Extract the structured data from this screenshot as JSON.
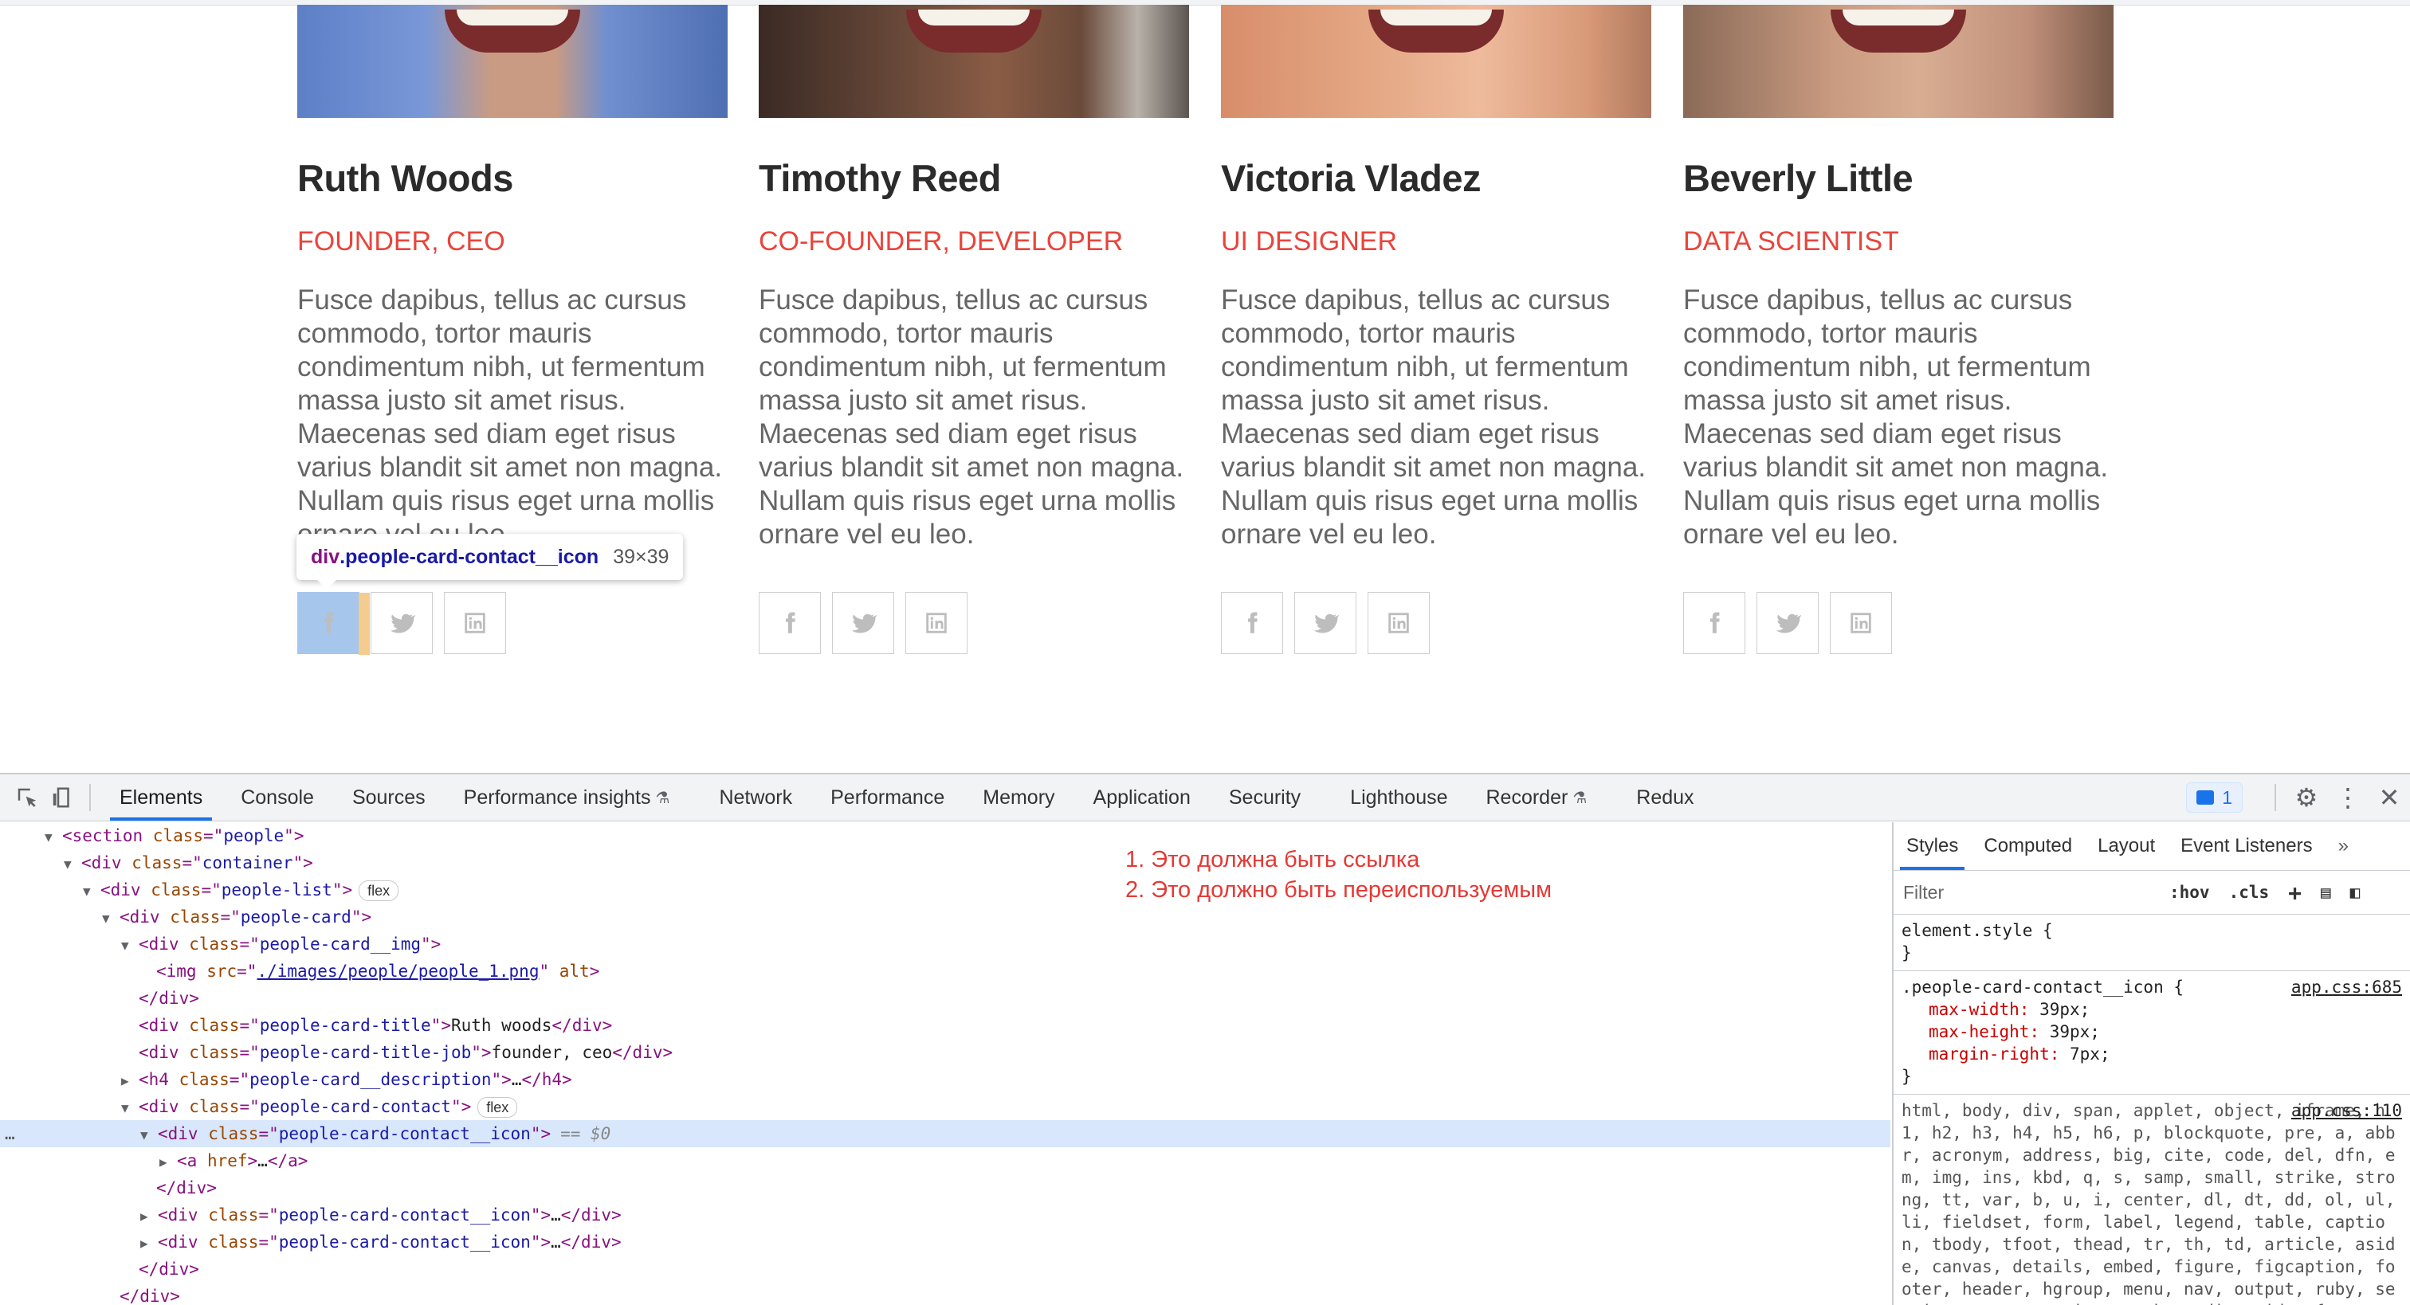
{
  "people": [
    {
      "name": "Ruth Woods",
      "job": "FOUNDER, CEO",
      "description": "Fusce dapibus, tellus ac cursus commodo, tortor mauris condimentum nibh, ut fermentum massa justo sit amet risus. Maecenas sed diam eget risus varius blandit sit amet non magna. Nullam quis risus eget urna mollis ornare vel eu leo.",
      "photo_color": "#6f8fd0"
    },
    {
      "name": "Timothy Reed",
      "job": "CO-FOUNDER, DEVELOPER",
      "description": "Fusce dapibus, tellus ac cursus commodo, tortor mauris condimentum nibh, ut fermentum massa justo sit amet risus. Maecenas sed diam eget risus varius blandit sit amet non magna. Nullam quis risus eget urna mollis ornare vel eu leo.",
      "photo_color": "#6b4a3a"
    },
    {
      "name": "Victoria Vladez",
      "job": "UI DESIGNER",
      "description": "Fusce dapibus, tellus ac cursus commodo, tortor mauris condimentum nibh, ut fermentum massa justo sit amet risus. Maecenas sed diam eget risus varius blandit sit amet non magna. Nullam quis risus eget urna mollis ornare vel eu leo.",
      "photo_color": "#e0a27f"
    },
    {
      "name": "Beverly Little",
      "job": "DATA SCIENTIST",
      "description": "Fusce dapibus, tellus ac cursus commodo, tortor mauris condimentum nibh, ut fermentum massa justo sit amet risus. Maecenas sed diam eget risus varius blandit sit amet non magna. Nullam quis risus eget urna mollis ornare vel eu leo.",
      "photo_color": "#c99b80"
    }
  ],
  "social_icons": [
    "facebook-icon",
    "twitter-icon",
    "linkedin-icon"
  ],
  "tooltip": {
    "tag": "div",
    "cls": ".people-card-contact__icon",
    "size": "39×39"
  },
  "devtools": {
    "tabs": [
      "Elements",
      "Console",
      "Sources",
      "Performance insights",
      "Network",
      "Performance",
      "Memory",
      "Application",
      "Security",
      "Lighthouse",
      "Recorder",
      "Redux"
    ],
    "active_tab": "Elements",
    "issues_count": "1",
    "note_lines": [
      "1. Это должна быть ссылка",
      "2. Это должно быть переиспользуемым"
    ],
    "dom": {
      "l1_attr": "class",
      "l1_val": "people",
      "l2_val": "container",
      "l3_val": "people-list",
      "l3_pill": "flex",
      "l4_val": "people-card",
      "l5_val": "people-card__img",
      "l6_src": "./images/people/people_1.png",
      "l6_alt": "alt",
      "l8_val": "people-card-title",
      "l8_text": "Ruth woods",
      "l9_val": "people-card-title-job",
      "l9_text": "founder, ceo",
      "l10_val": "people-card__description",
      "l11_val": "people-card-contact",
      "l11_pill": "flex",
      "l12_val": "people-card-contact__icon",
      "l12_marker": "== $0",
      "l13_text": "href",
      "l15_val": "people-card-contact__icon",
      "l16_val": "people-card-contact__icon"
    },
    "styles": {
      "tabs": [
        "Styles",
        "Computed",
        "Layout",
        "Event Listeners"
      ],
      "active_tab": "Styles",
      "filter_placeholder": "Filter",
      "hov": ":hov",
      "cls": ".cls",
      "element_style": "element.style {",
      "close_brace": "}",
      "rule1_selector": ".people-card-contact__icon {",
      "rule1_source": "app.css:685",
      "rule1_props": [
        {
          "name": "max-width",
          "value": "39px;"
        },
        {
          "name": "max-height",
          "value": "39px;"
        },
        {
          "name": "margin-right",
          "value": "7px;"
        }
      ],
      "rule2_source": "app.css:110",
      "rule2_selector": "html, body, div, span, applet, object, iframe, h1, h2, h3, h4, h5, h6, p, blockquote, pre, a, abbr, acronym, address, big, cite, code, del, dfn, em, img, ins, kbd, q, s, samp, small, strike, strong, tt, var, b, u, i, center, dl, dt, dd, ol, ul, li, fieldset, form, label, legend, table, caption, tbody, tfoot, thead, tr, th, td, article, aside, canvas, details, embed, figure, figcaption, footer, header, hgroup, menu, nav, output, ruby, section, summary, time, mark, audio, video {"
    }
  }
}
